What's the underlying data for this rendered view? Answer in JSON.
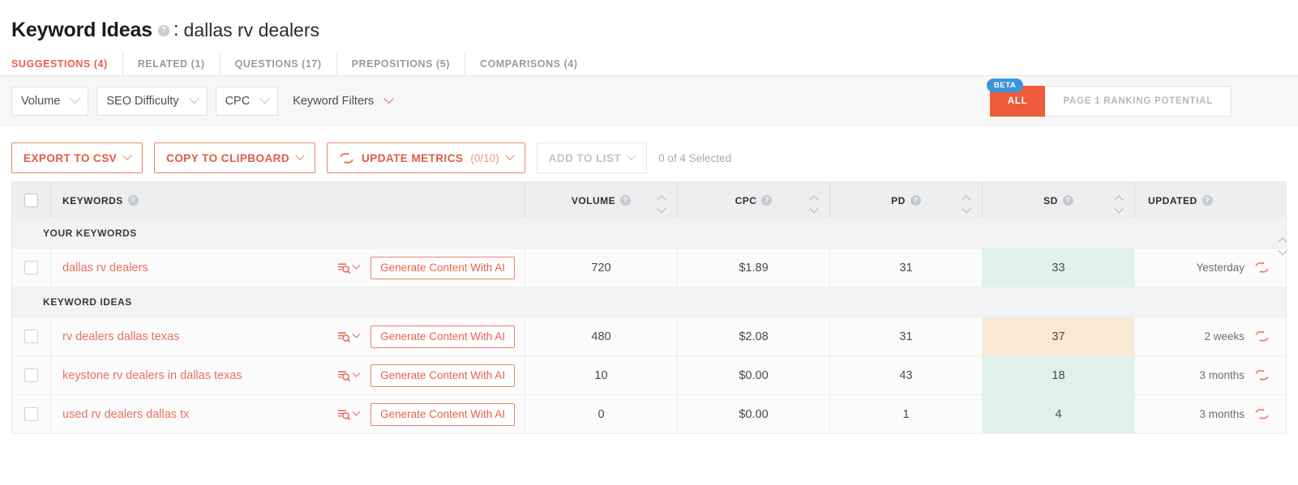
{
  "header": {
    "title": "Keyword Ideas",
    "help_icon": "help-circle-icon",
    "separator": ":",
    "keyword": "dallas rv dealers"
  },
  "tabs": [
    {
      "label": "SUGGESTIONS (4)",
      "active": true
    },
    {
      "label": "RELATED (1)",
      "active": false
    },
    {
      "label": "QUESTIONS (17)",
      "active": false
    },
    {
      "label": "PREPOSITIONS (5)",
      "active": false
    },
    {
      "label": "COMPARISONS (4)",
      "active": false
    }
  ],
  "filters": [
    {
      "label": "Volume",
      "boxed": true,
      "chevron_color": "#b9bcbf"
    },
    {
      "label": "SEO Difficulty",
      "boxed": true,
      "chevron_color": "#b9bcbf"
    },
    {
      "label": "CPC",
      "boxed": true,
      "chevron_color": "#b9bcbf"
    },
    {
      "label": "Keyword Filters",
      "boxed": false,
      "chevron_color": "#e8604c"
    }
  ],
  "view_toggle": {
    "beta_badge": "BETA",
    "options": [
      {
        "label": "ALL",
        "selected": true
      },
      {
        "label": "PAGE 1 RANKING POTENTIAL",
        "selected": false
      }
    ],
    "active_color": "#ef5a3b",
    "badge_color": "#3b94d9"
  },
  "actions": {
    "export": "EXPORT TO CSV",
    "copy": "COPY TO CLIPBOARD",
    "update_metrics": "UPDATE METRICS",
    "update_metrics_count": "(0/10)",
    "add_to_list": "ADD TO LIST",
    "selected_status": "0 of 4 Selected"
  },
  "table": {
    "columns": [
      {
        "label": "KEYWORDS",
        "help": true,
        "sortable": true
      },
      {
        "label": "VOLUME",
        "help": true,
        "sortable": true
      },
      {
        "label": "CPC",
        "help": true,
        "sortable": true
      },
      {
        "label": "PD",
        "help": true,
        "sortable": true
      },
      {
        "label": "SD",
        "help": true,
        "sortable": true
      },
      {
        "label": "UPDATED",
        "help": true,
        "sortable": false
      }
    ],
    "groups": [
      {
        "label": "YOUR KEYWORDS",
        "rows": [
          {
            "keyword": "dallas rv dealers",
            "generate_label": "Generate Content With AI",
            "volume": "720",
            "cpc": "$1.89",
            "pd": "31",
            "sd": "33",
            "sd_highlight": "green",
            "updated": "Yesterday"
          }
        ]
      },
      {
        "label": "KEYWORD IDEAS",
        "rows": [
          {
            "keyword": "rv dealers dallas texas",
            "generate_label": "Generate Content With AI",
            "volume": "480",
            "cpc": "$2.08",
            "pd": "31",
            "sd": "37",
            "sd_highlight": "peach",
            "updated": "2 weeks"
          },
          {
            "keyword": "keystone rv dealers in dallas texas",
            "generate_label": "Generate Content With AI",
            "volume": "10",
            "cpc": "$0.00",
            "pd": "43",
            "sd": "18",
            "sd_highlight": "green",
            "updated": "3 months"
          },
          {
            "keyword": "used rv dealers dallas tx",
            "generate_label": "Generate Content With AI",
            "volume": "0",
            "cpc": "$0.00",
            "pd": "1",
            "sd": "4",
            "sd_highlight": "green",
            "updated": "3 months"
          }
        ]
      }
    ],
    "icons": {
      "serp_analysis": "serp-analysis-icon",
      "refresh": "refresh-icon",
      "checkbox": "checkbox-icon"
    }
  },
  "colors": {
    "accent": "#e8604c",
    "accent_solid": "#ef5a3b",
    "beta_blue": "#3b94d9",
    "sd_green": "#dff1ea",
    "sd_peach": "#f8e8d4",
    "muted": "#9b9b9b"
  }
}
